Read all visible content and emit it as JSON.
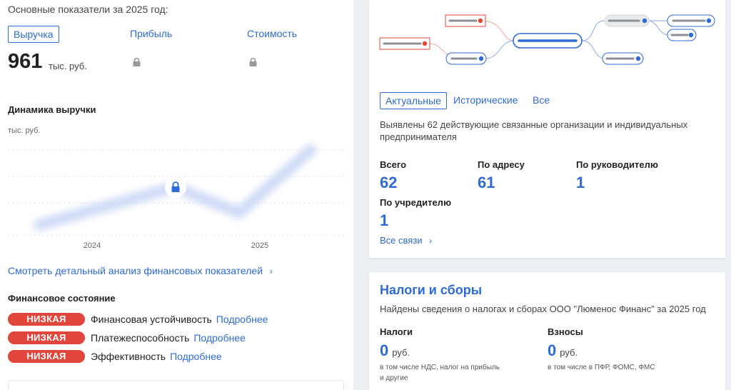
{
  "finance": {
    "header": "Основные показатели за 2025 год:",
    "tabs": {
      "revenue": "Выручка",
      "profit": "Прибыль",
      "value": "Стоимость"
    },
    "revenue_value": "961",
    "revenue_unit": "тыс. руб.",
    "dynamics_title": "Динамика выручки",
    "chart_unit_label": "тыс. руб.",
    "detail_link": "Смотреть детальный анализ финансовых показателей",
    "state_title": "Финансовое состояние",
    "state_items": [
      {
        "badge": "НИЗКАЯ",
        "label": "Финансовая устойчивость",
        "more": "Подробнее"
      },
      {
        "badge": "НИЗКАЯ",
        "label": "Платежеспособность",
        "more": "Подробнее"
      },
      {
        "badge": "НИЗКАЯ",
        "label": "Эффективность",
        "more": "Подробнее"
      }
    ]
  },
  "chart_data": {
    "type": "line",
    "categories": [
      "2024",
      "2025"
    ],
    "ylabel": "тыс. руб.",
    "locked": true,
    "values": [],
    "grid": true
  },
  "links": {
    "tabs": {
      "current": "Актуальные",
      "historical": "Исторические",
      "all": "Все"
    },
    "description": "Выявлены 62 действующие связанные организации и индивидуальных предпринимателя",
    "stats": {
      "total_label": "Всего",
      "total_value": "62",
      "address_label": "По адресу",
      "address_value": "61",
      "director_label": "По руководителю",
      "director_value": "1",
      "founder_label": "По учредителю",
      "founder_value": "1"
    },
    "all_links": "Все связи"
  },
  "taxes": {
    "title": "Налоги и сборы",
    "description": "Найдены сведения о налогах и сборах ООО \"Люменос Финанс\" за 2025 год",
    "taxes_label": "Налоги",
    "taxes_value": "0",
    "taxes_unit": "руб.",
    "taxes_note_1": "в том числе НДС, налог на прибыль",
    "taxes_note_2": "и другие",
    "fees_label": "Взносы",
    "fees_value": "0",
    "fees_unit": "руб.",
    "fees_note": "в том числе в ПФР, ФОМС, ФМС"
  },
  "colors": {
    "accent": "#2e6bd6",
    "danger": "#e0463b",
    "text": "#222222",
    "muted": "#666666"
  }
}
